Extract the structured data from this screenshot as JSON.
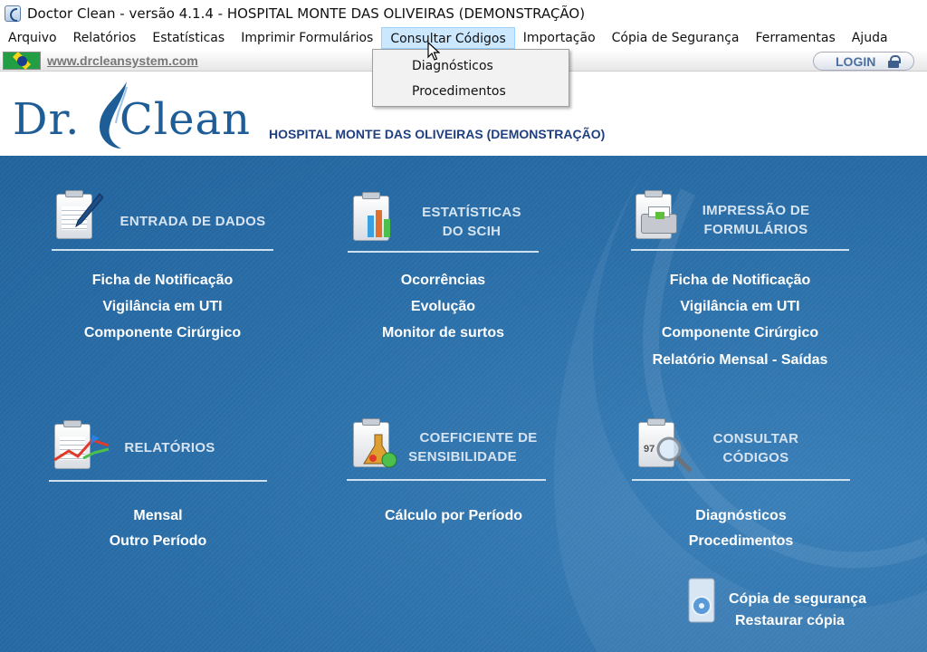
{
  "window": {
    "title": "Doctor Clean - versão 4.1.4 - HOSPITAL MONTE DAS OLIVEIRAS (DEMONSTRAÇÃO)"
  },
  "menubar": {
    "items": [
      "Arquivo",
      "Relatórios",
      "Estatísticas",
      "Imprimir Formulários",
      "Consultar Códigos",
      "Importação",
      "Cópia de Segurança",
      "Ferramentas",
      "Ajuda"
    ]
  },
  "dropdown": {
    "items": [
      "Diagnósticos",
      "Procedimentos"
    ]
  },
  "linkbar": {
    "site": "www.drcleansystem.com",
    "login": "LOGIN"
  },
  "header": {
    "logo_dr": "Dr.",
    "logo_clean": "Clean",
    "hospital": "HOSPITAL MONTE DAS OLIVEIRAS (DEMONSTRAÇÃO)"
  },
  "sections": {
    "entrada": {
      "title": "ENTRADA DE DADOS",
      "links": [
        "Ficha de Notificação",
        "Vigilância em UTI",
        "Componente Cirúrgico"
      ]
    },
    "estatisticas": {
      "title_line1": "ESTATÍSTICAS",
      "title_line2": "DO SCIH",
      "links": [
        "Ocorrências",
        "Evolução",
        "Monitor de surtos"
      ]
    },
    "impressao": {
      "title_line1": "IMPRESSÃO DE",
      "title_line2": "FORMULÁRIOS",
      "links": [
        "Ficha de Notificação",
        "Vigilância em UTI",
        "Componente Cirúrgico",
        "Relatório Mensal - Saídas"
      ]
    },
    "relatorios": {
      "title": "RELATÓRIOS",
      "links": [
        "Mensal",
        "Outro Período"
      ]
    },
    "coeficiente": {
      "title_line1": "COEFICIENTE DE",
      "title_line2": "SENSIBILIDADE",
      "links": [
        "Cálculo por Período"
      ]
    },
    "consultar": {
      "title_line1": "CONSULTAR",
      "title_line2": "CÓDIGOS",
      "icon_text": "97",
      "links": [
        "Diagnósticos",
        "Procedimentos"
      ]
    },
    "backup": {
      "links": [
        "Cópia de segurança",
        "Restaurar cópia"
      ]
    }
  },
  "colors": {
    "panel_blue": "#2a6ea8",
    "logo_blue": "#1f5d97",
    "menu_highlight": "#cce8ff"
  }
}
